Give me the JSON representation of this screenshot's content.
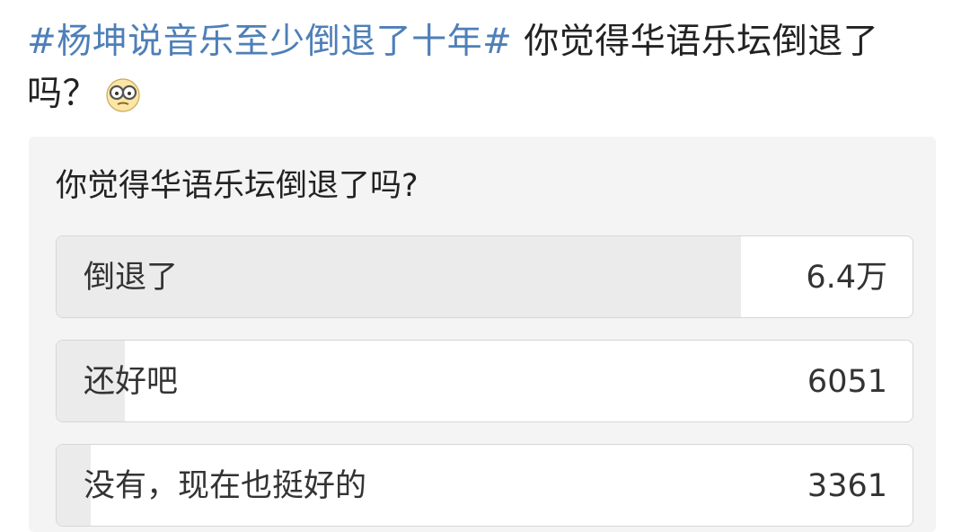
{
  "post": {
    "hashtag": "#杨坤说音乐至少倒退了十年#",
    "text": " 你觉得华语乐坛倒退了吗？",
    "emoji": "nerd-glasses-face-emoji"
  },
  "poll": {
    "question": "你觉得华语乐坛倒退了吗?",
    "options": [
      {
        "label": "倒退了",
        "count": "6.4万",
        "share": 0.8
      },
      {
        "label": "还好吧",
        "count": "6051",
        "share": 0.08
      },
      {
        "label": "没有，现在也挺好的",
        "count": "3361",
        "share": 0.04
      }
    ]
  },
  "colors": {
    "hashtag": "#4e7fb8",
    "card_bg": "#f4f4f4",
    "fill": "#ebebeb"
  }
}
